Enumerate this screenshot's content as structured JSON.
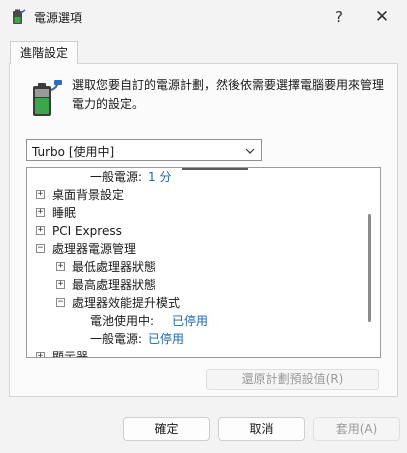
{
  "window": {
    "title": "電源選項",
    "help_glyph": "?",
    "close_glyph": "✕"
  },
  "tab": {
    "label": "進階設定"
  },
  "description": "選取您要自訂的電源計劃，然後依需要選擇電腦要用來管理電力的設定。",
  "plan_combo": {
    "value": "Turbo [使用中]"
  },
  "tree": {
    "top_partial": {
      "label": "一般電源:",
      "value": "1 分"
    },
    "items": [
      {
        "expander": "+",
        "label": "桌面背景設定"
      },
      {
        "expander": "+",
        "label": "睡眠"
      },
      {
        "expander": "+",
        "label": "PCI Express"
      },
      {
        "expander": "−",
        "label": "處理器電源管理"
      },
      {
        "expander": "+",
        "label": "最低處理器狀態"
      },
      {
        "expander": "+",
        "label": "最高處理器狀態"
      },
      {
        "expander": "−",
        "label": "處理器效能提升模式"
      },
      {
        "label": "電池使用中:",
        "value": "已停用"
      },
      {
        "label": "一般電源:",
        "value": "已停用"
      },
      {
        "expander": "+",
        "label": "顯示器"
      }
    ]
  },
  "restore_button": {
    "label": "還原計劃預設值(R)"
  },
  "buttons": {
    "ok": "確定",
    "cancel": "取消",
    "apply": "套用(A)"
  },
  "colors": {
    "value_link": "#1a66b8",
    "battery_green": "#3aa84a"
  }
}
